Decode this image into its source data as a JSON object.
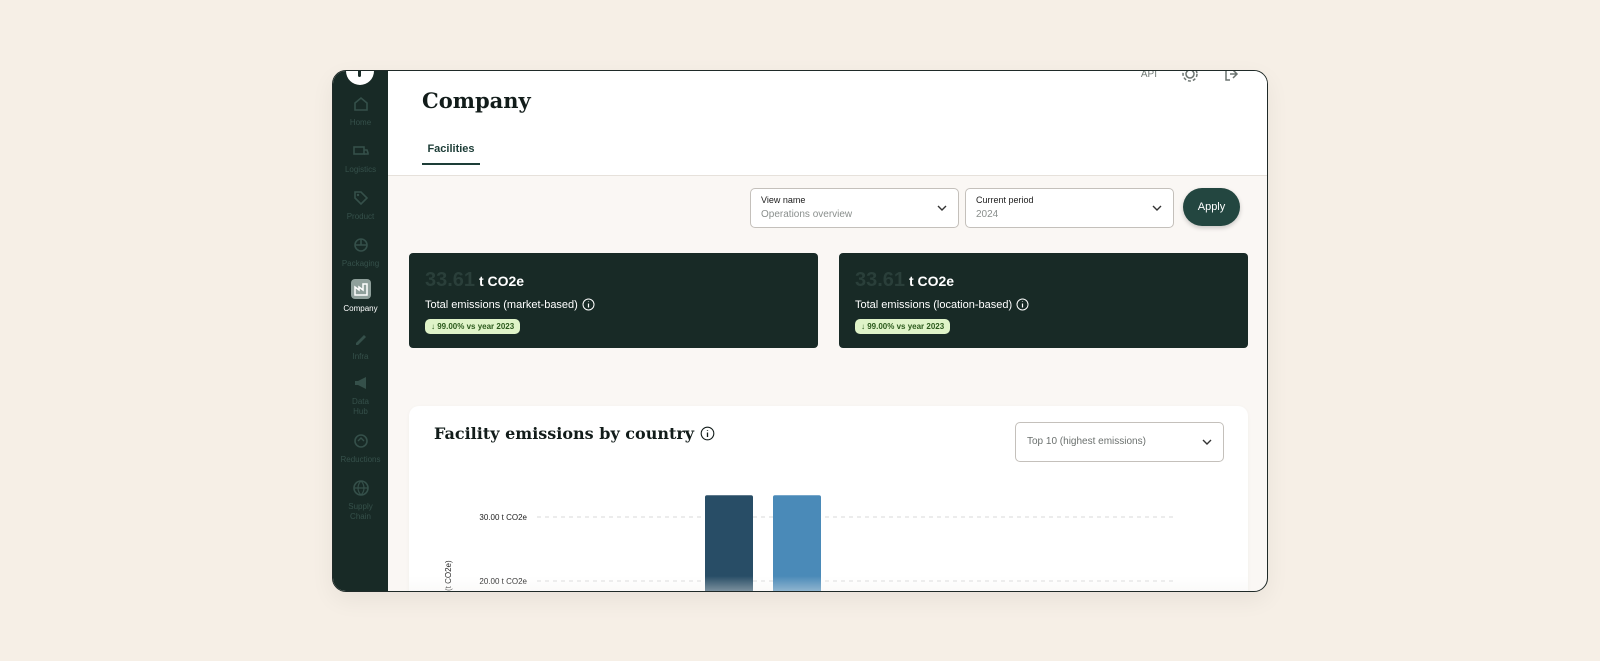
{
  "sidebar": {
    "items": [
      {
        "label": "Home",
        "icon": "home-icon"
      },
      {
        "label": "Logistics",
        "icon": "truck-icon"
      },
      {
        "label": "Product",
        "icon": "tag-icon"
      },
      {
        "label": "Packaging",
        "icon": "package-icon"
      },
      {
        "label": "Company",
        "icon": "factory-icon",
        "active": true
      },
      {
        "label": "Infra",
        "icon": "pen-icon"
      },
      {
        "label": "Data",
        "sub": "Hub",
        "icon": "megaphone-icon"
      },
      {
        "label": "Reductions",
        "icon": "leaf-icon"
      },
      {
        "label": "Supply",
        "sub": "Chain",
        "icon": "globe-icon"
      }
    ]
  },
  "header": {
    "title": "Company",
    "api_label": "API",
    "tabs": [
      "Facilities"
    ]
  },
  "filters": {
    "view": {
      "label": "View name",
      "value": "Operations overview"
    },
    "period": {
      "label": "Current period",
      "value": "2024"
    },
    "apply_label": "Apply"
  },
  "kpis": [
    {
      "value": "33.61",
      "unit": "t CO2e",
      "label": "Total emissions (market-based)",
      "badge": "↓ 99.00% vs year 2023"
    },
    {
      "value": "33.61",
      "unit": "t CO2e",
      "label": "Total emissions (location-based)",
      "badge": "↓ 99.00% vs year 2023"
    }
  ],
  "chart_section": {
    "title": "Facility emissions by country",
    "select_value": "Top 10 (highest emissions)"
  },
  "chart_data": {
    "type": "bar",
    "ylabel": "(t CO2e)",
    "yticks": [
      "30.00 t CO2e",
      "20.00 t CO2e"
    ],
    "ytick_values": [
      30,
      20
    ],
    "series": [
      {
        "values": [
          33.4
        ],
        "color": "#284d66"
      },
      {
        "values": [
          33.4
        ],
        "color": "#4a8ab8"
      }
    ]
  }
}
